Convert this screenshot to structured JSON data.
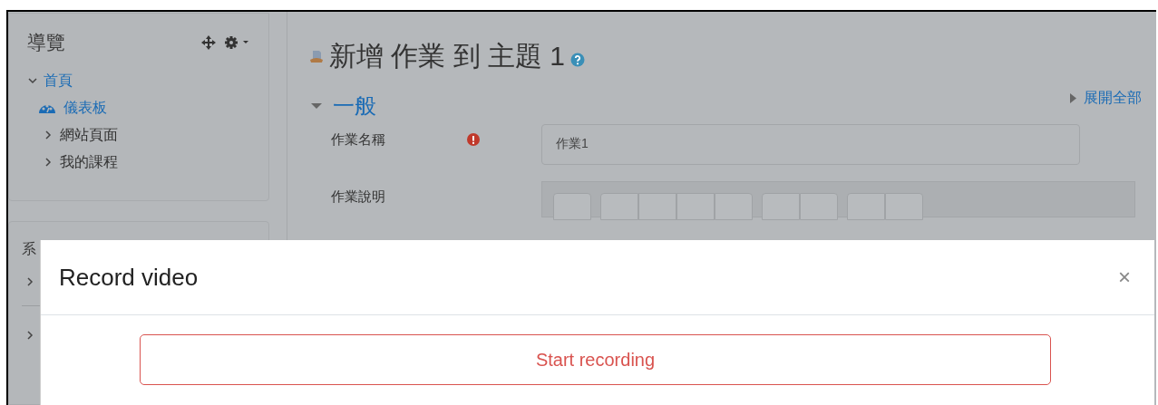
{
  "nav_block": {
    "title": "導覽",
    "items": [
      {
        "label": "首頁",
        "kind": "open-branch",
        "children": [
          {
            "label": "儀表板",
            "kind": "dashboard"
          },
          {
            "label": "網站頁面",
            "kind": "branch"
          },
          {
            "label": "我的課程",
            "kind": "branch"
          }
        ]
      }
    ]
  },
  "second_block": {
    "title_fragment": "系"
  },
  "page": {
    "title": "新增 作業 到 主題 1",
    "expand_all": "展開全部",
    "section": {
      "title": "一般",
      "expanded": true
    },
    "fields": [
      {
        "label": "作業名稱",
        "required": true,
        "value": "作業1",
        "kind": "text"
      },
      {
        "label": "作業說明",
        "required": false,
        "kind": "editor"
      }
    ]
  },
  "modal": {
    "title": "Record video",
    "close": "×",
    "button": "Start recording"
  }
}
